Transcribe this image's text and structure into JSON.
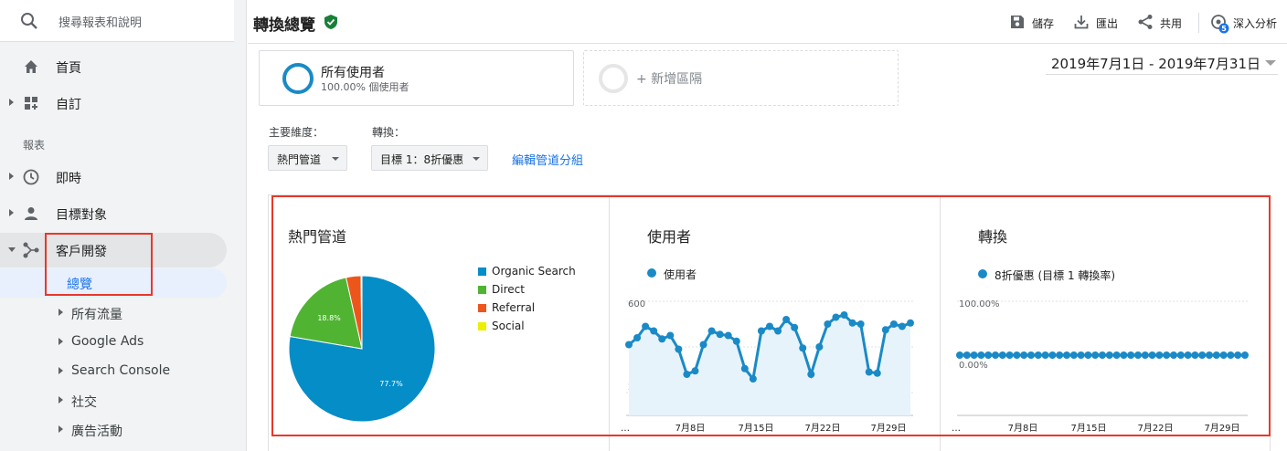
{
  "sidebar": {
    "search_label": "搜尋報表和說明",
    "home": "首頁",
    "custom": "自訂",
    "reports_section": "報表",
    "realtime": "即時",
    "audience": "目標對象",
    "acquisition": "客戶開發",
    "overview": "總覽",
    "sub_items": [
      "所有流量",
      "Google Ads",
      "Search Console",
      "社交",
      "廣告活動"
    ]
  },
  "header": {
    "title": "轉換總覽",
    "save": "儲存",
    "export": "匯出",
    "share": "共用",
    "insights": "深入分析",
    "insights_badge": "5"
  },
  "segments": {
    "all_users": "所有使用者",
    "all_users_pct": "100.00% 個使用者",
    "add_segment": "+ 新增區隔"
  },
  "date_range": "2019年7月1日 - 2019年7月31日",
  "controls": {
    "primary_dimension_label": "主要維度：",
    "primary_dimension_value": "熱門管道",
    "conversion_label": "轉換：",
    "conversion_value": "目標 1：8折優惠",
    "edit_grouping": "編輯管道分組"
  },
  "colors": {
    "organic": "#058dc7",
    "direct": "#50b432",
    "referral": "#ed561b",
    "social": "#edef00",
    "accent": "#1a8ac6",
    "highlight": "#e8382a"
  },
  "chart_data": [
    {
      "type": "pie",
      "title": "熱門管道",
      "labels": [
        "Organic Search",
        "Direct",
        "Referral",
        "Social"
      ],
      "values": [
        77.7,
        18.8,
        3.3,
        0.2
      ],
      "data_labels": [
        "77.7%",
        "18.8%"
      ]
    },
    {
      "type": "area",
      "title": "使用者",
      "series": [
        {
          "name": "使用者",
          "values": [
            410,
            440,
            490,
            470,
            435,
            450,
            390,
            280,
            295,
            410,
            470,
            455,
            450,
            425,
            305,
            260,
            470,
            490,
            470,
            520,
            485,
            395,
            280,
            400,
            500,
            530,
            540,
            505,
            500,
            290,
            285,
            475,
            500,
            490,
            505
          ]
        }
      ],
      "x_ticks": [
        "…",
        "7月8日",
        "7月15日",
        "7月22日",
        "7月29日"
      ],
      "y_ticks": [
        "600",
        "400",
        "200"
      ],
      "ylim": [
        100,
        600
      ]
    },
    {
      "type": "line",
      "title": "轉換",
      "series": [
        {
          "name": "8折優惠 (目標 1 轉換率)",
          "values": [
            0,
            0,
            0,
            0,
            0,
            0,
            0,
            0,
            0,
            0,
            0,
            0,
            0,
            0,
            0,
            0,
            0,
            0,
            0,
            0,
            0,
            0,
            0,
            0,
            0,
            0,
            0,
            0,
            0,
            0,
            0,
            0,
            0,
            0,
            0,
            0,
            0,
            0,
            0,
            0,
            0
          ]
        }
      ],
      "x_ticks": [
        "…",
        "7月8日",
        "7月15日",
        "7月22日",
        "7月29日"
      ],
      "y_ticks": [
        "100.00%",
        "0.00%"
      ]
    }
  ]
}
